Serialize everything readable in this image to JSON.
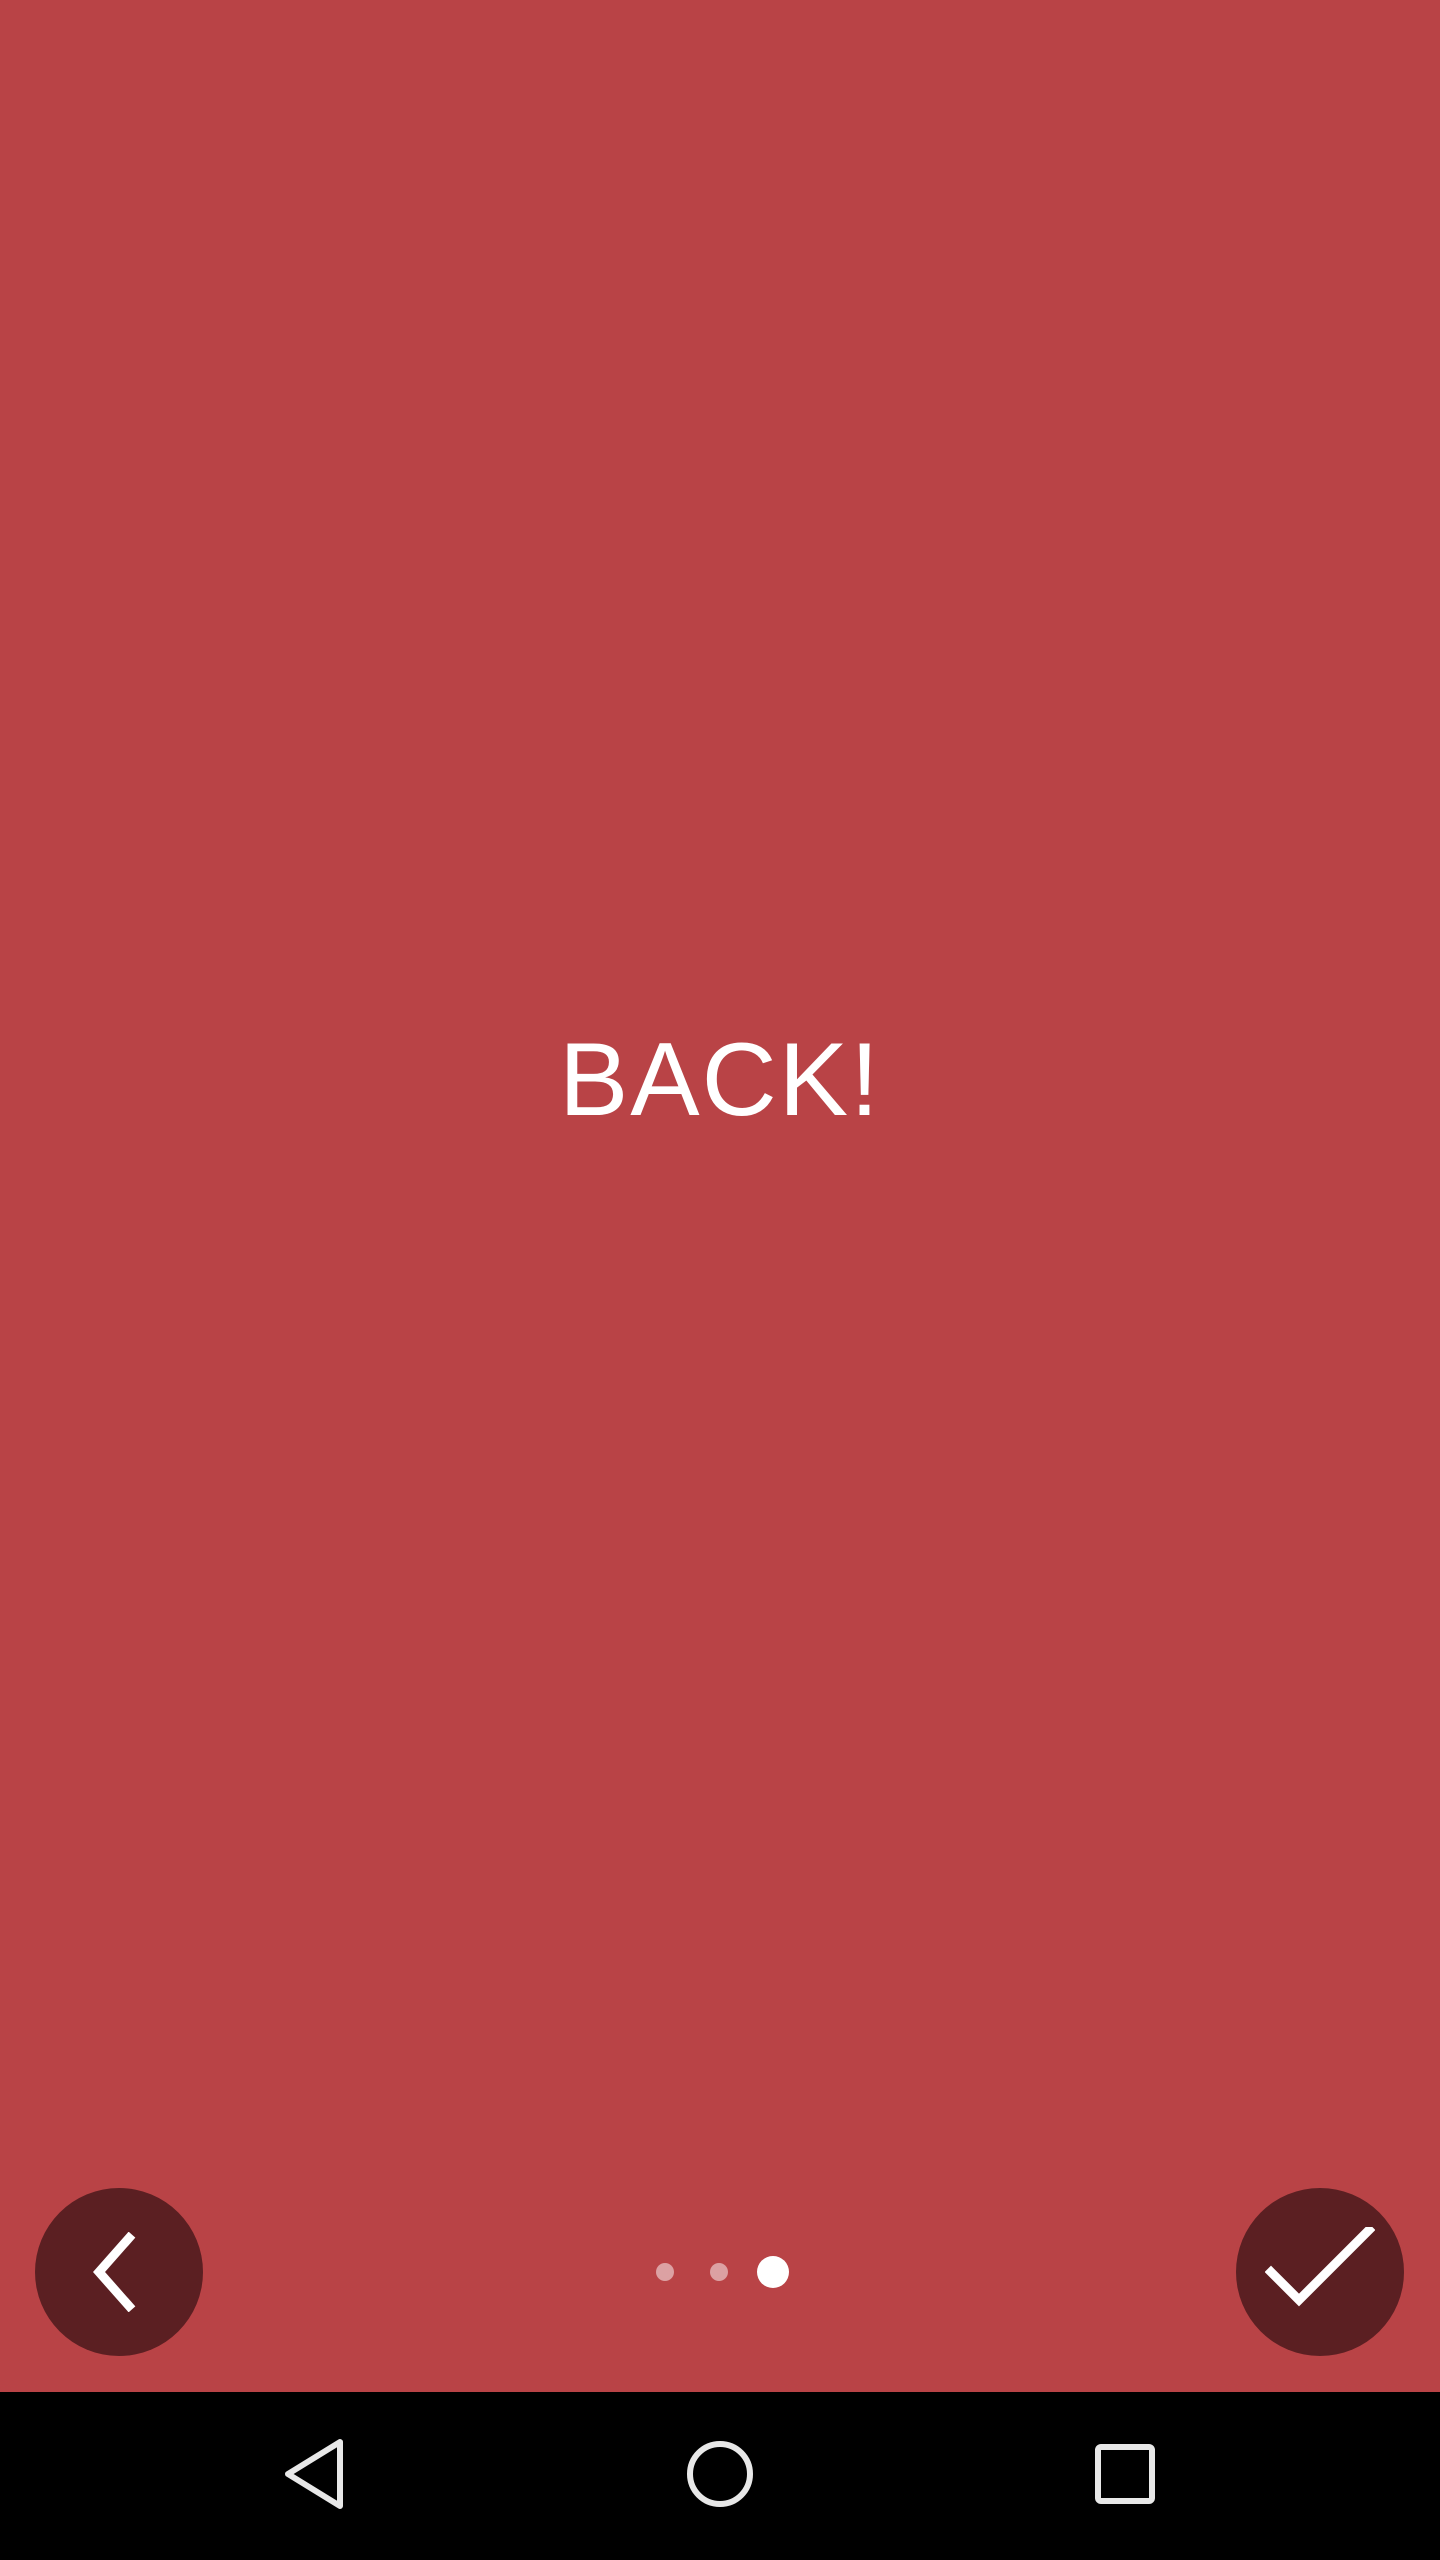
{
  "onboarding": {
    "message": "BACK!",
    "background_color": "#b94346",
    "fab_color": "#5b1f22",
    "back_button_icon": "chevron-left-icon",
    "done_button_icon": "checkmark-icon",
    "pager": {
      "total_pages": 3,
      "current_page": 3
    }
  },
  "system_nav": {
    "back_icon": "triangle-back-icon",
    "home_icon": "circle-home-icon",
    "recents_icon": "square-recents-icon"
  }
}
